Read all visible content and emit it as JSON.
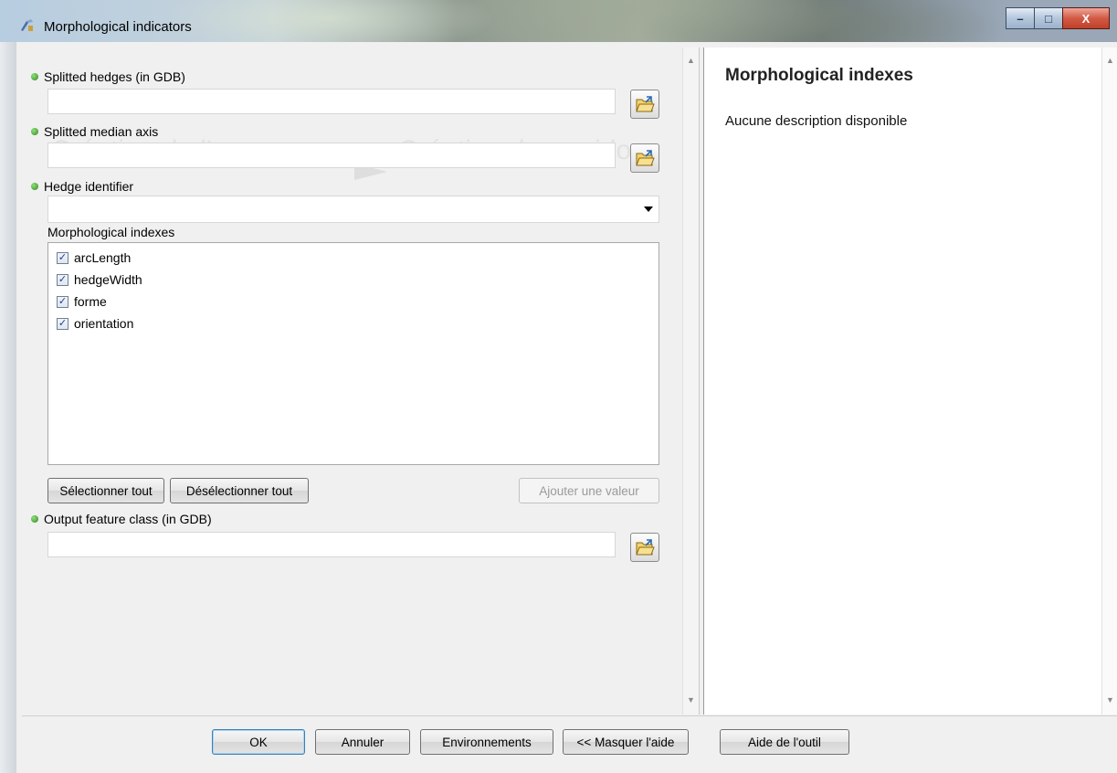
{
  "window": {
    "title": "Morphological indicators",
    "minimize_glyph": "–",
    "maximize_glyph": "□",
    "close_glyph": "X"
  },
  "form": {
    "splitted_hedges": {
      "label": "Splitted hedges (in GDB)",
      "value": ""
    },
    "splitted_median_axis": {
      "label": "Splitted median axis",
      "value": ""
    },
    "hedge_identifier": {
      "label": "Hedge identifier",
      "value": ""
    },
    "morphological_indexes": {
      "label": "Morphological indexes",
      "items": [
        {
          "label": "arcLength",
          "checked": true
        },
        {
          "label": "hedgeWidth",
          "checked": true
        },
        {
          "label": "forme",
          "checked": true
        },
        {
          "label": "orientation",
          "checked": true
        }
      ],
      "select_all_label": "Sélectionner tout",
      "deselect_all_label": "Désélectionner tout",
      "add_value_label": "Ajouter une valeur"
    },
    "output_feature_class": {
      "label": "Output feature class (in GDB)",
      "value": ""
    }
  },
  "help": {
    "title": "Morphological indexes",
    "description": "Aucune description disponible"
  },
  "footer": {
    "ok_label": "OK",
    "cancel_label": "Annuler",
    "environments_label": "Environnements",
    "hide_help_label": "<< Masquer l'aide",
    "tool_help_label": "Aide de l'outil"
  },
  "colors": {
    "required_dot": "#3a9a2a",
    "titlebar": "#9fb7cf",
    "close_button": "#c0402a"
  },
  "icons": {
    "app": "toolbox-icon",
    "browse": "folder-open-icon",
    "dropdown": "chevron-down-icon",
    "checkbox_mark": "✓"
  }
}
